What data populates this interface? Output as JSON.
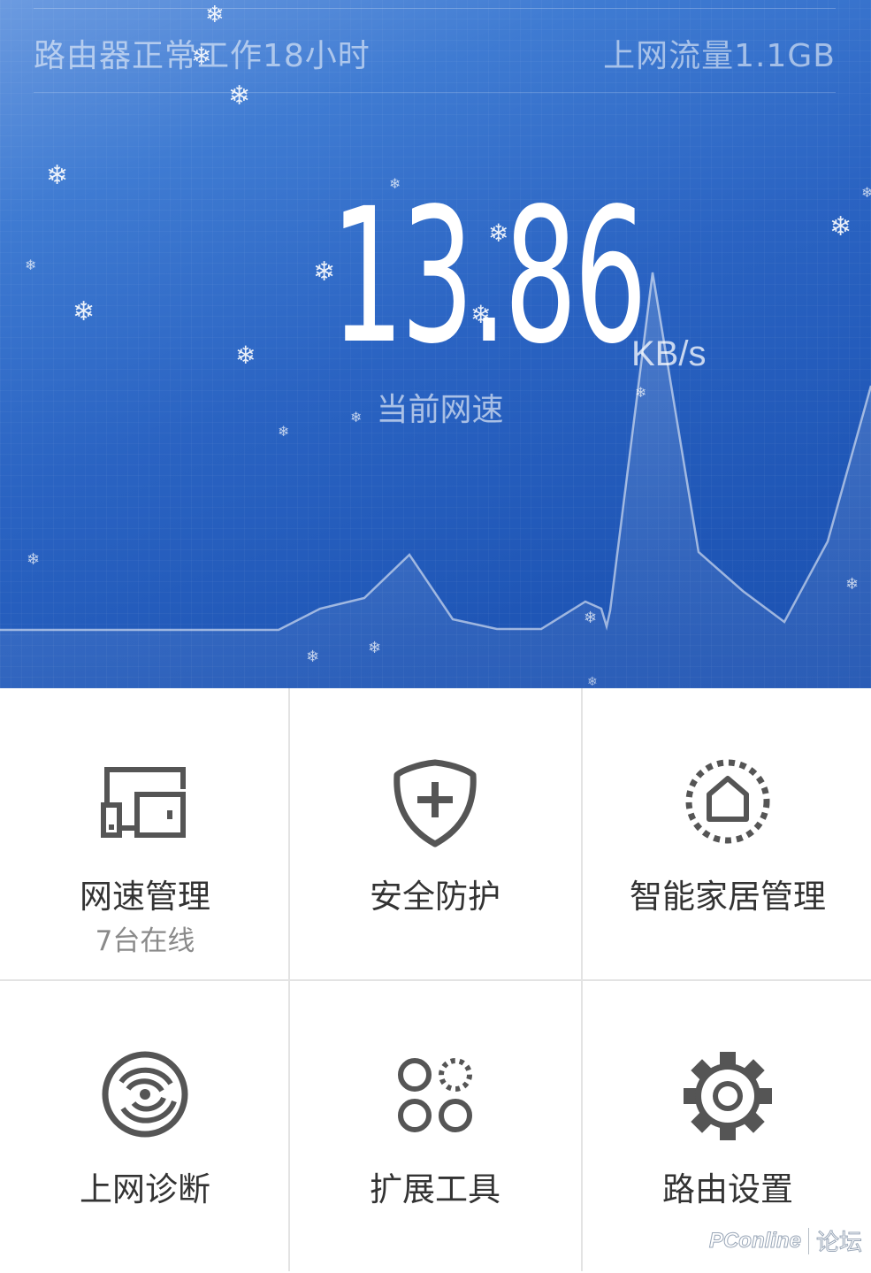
{
  "header": {
    "uptime_text": "路由器正常工作18小时",
    "traffic_text": "上网流量1.1GB"
  },
  "speed": {
    "value": "13.86",
    "unit": "KB/s",
    "label": "当前网速"
  },
  "menu": [
    {
      "label": "网速管理",
      "sub": "7台在线",
      "icon": "devices-icon"
    },
    {
      "label": "安全防护",
      "sub": "",
      "icon": "shield-plus-icon"
    },
    {
      "label": "智能家居管理",
      "sub": "",
      "icon": "smart-home-icon"
    },
    {
      "label": "上网诊断",
      "sub": "",
      "icon": "diagnosis-disc-icon"
    },
    {
      "label": "扩展工具",
      "sub": "",
      "icon": "extension-circles-icon"
    },
    {
      "label": "路由设置",
      "sub": "",
      "icon": "gear-icon"
    }
  ],
  "watermark": {
    "logo": "PConline",
    "forum": "论坛"
  },
  "colors": {
    "hero_top": "#6c9be0",
    "hero_bottom": "#1d52b1",
    "icon": "#555555",
    "label": "#333333",
    "sub": "#8a8a8a"
  }
}
